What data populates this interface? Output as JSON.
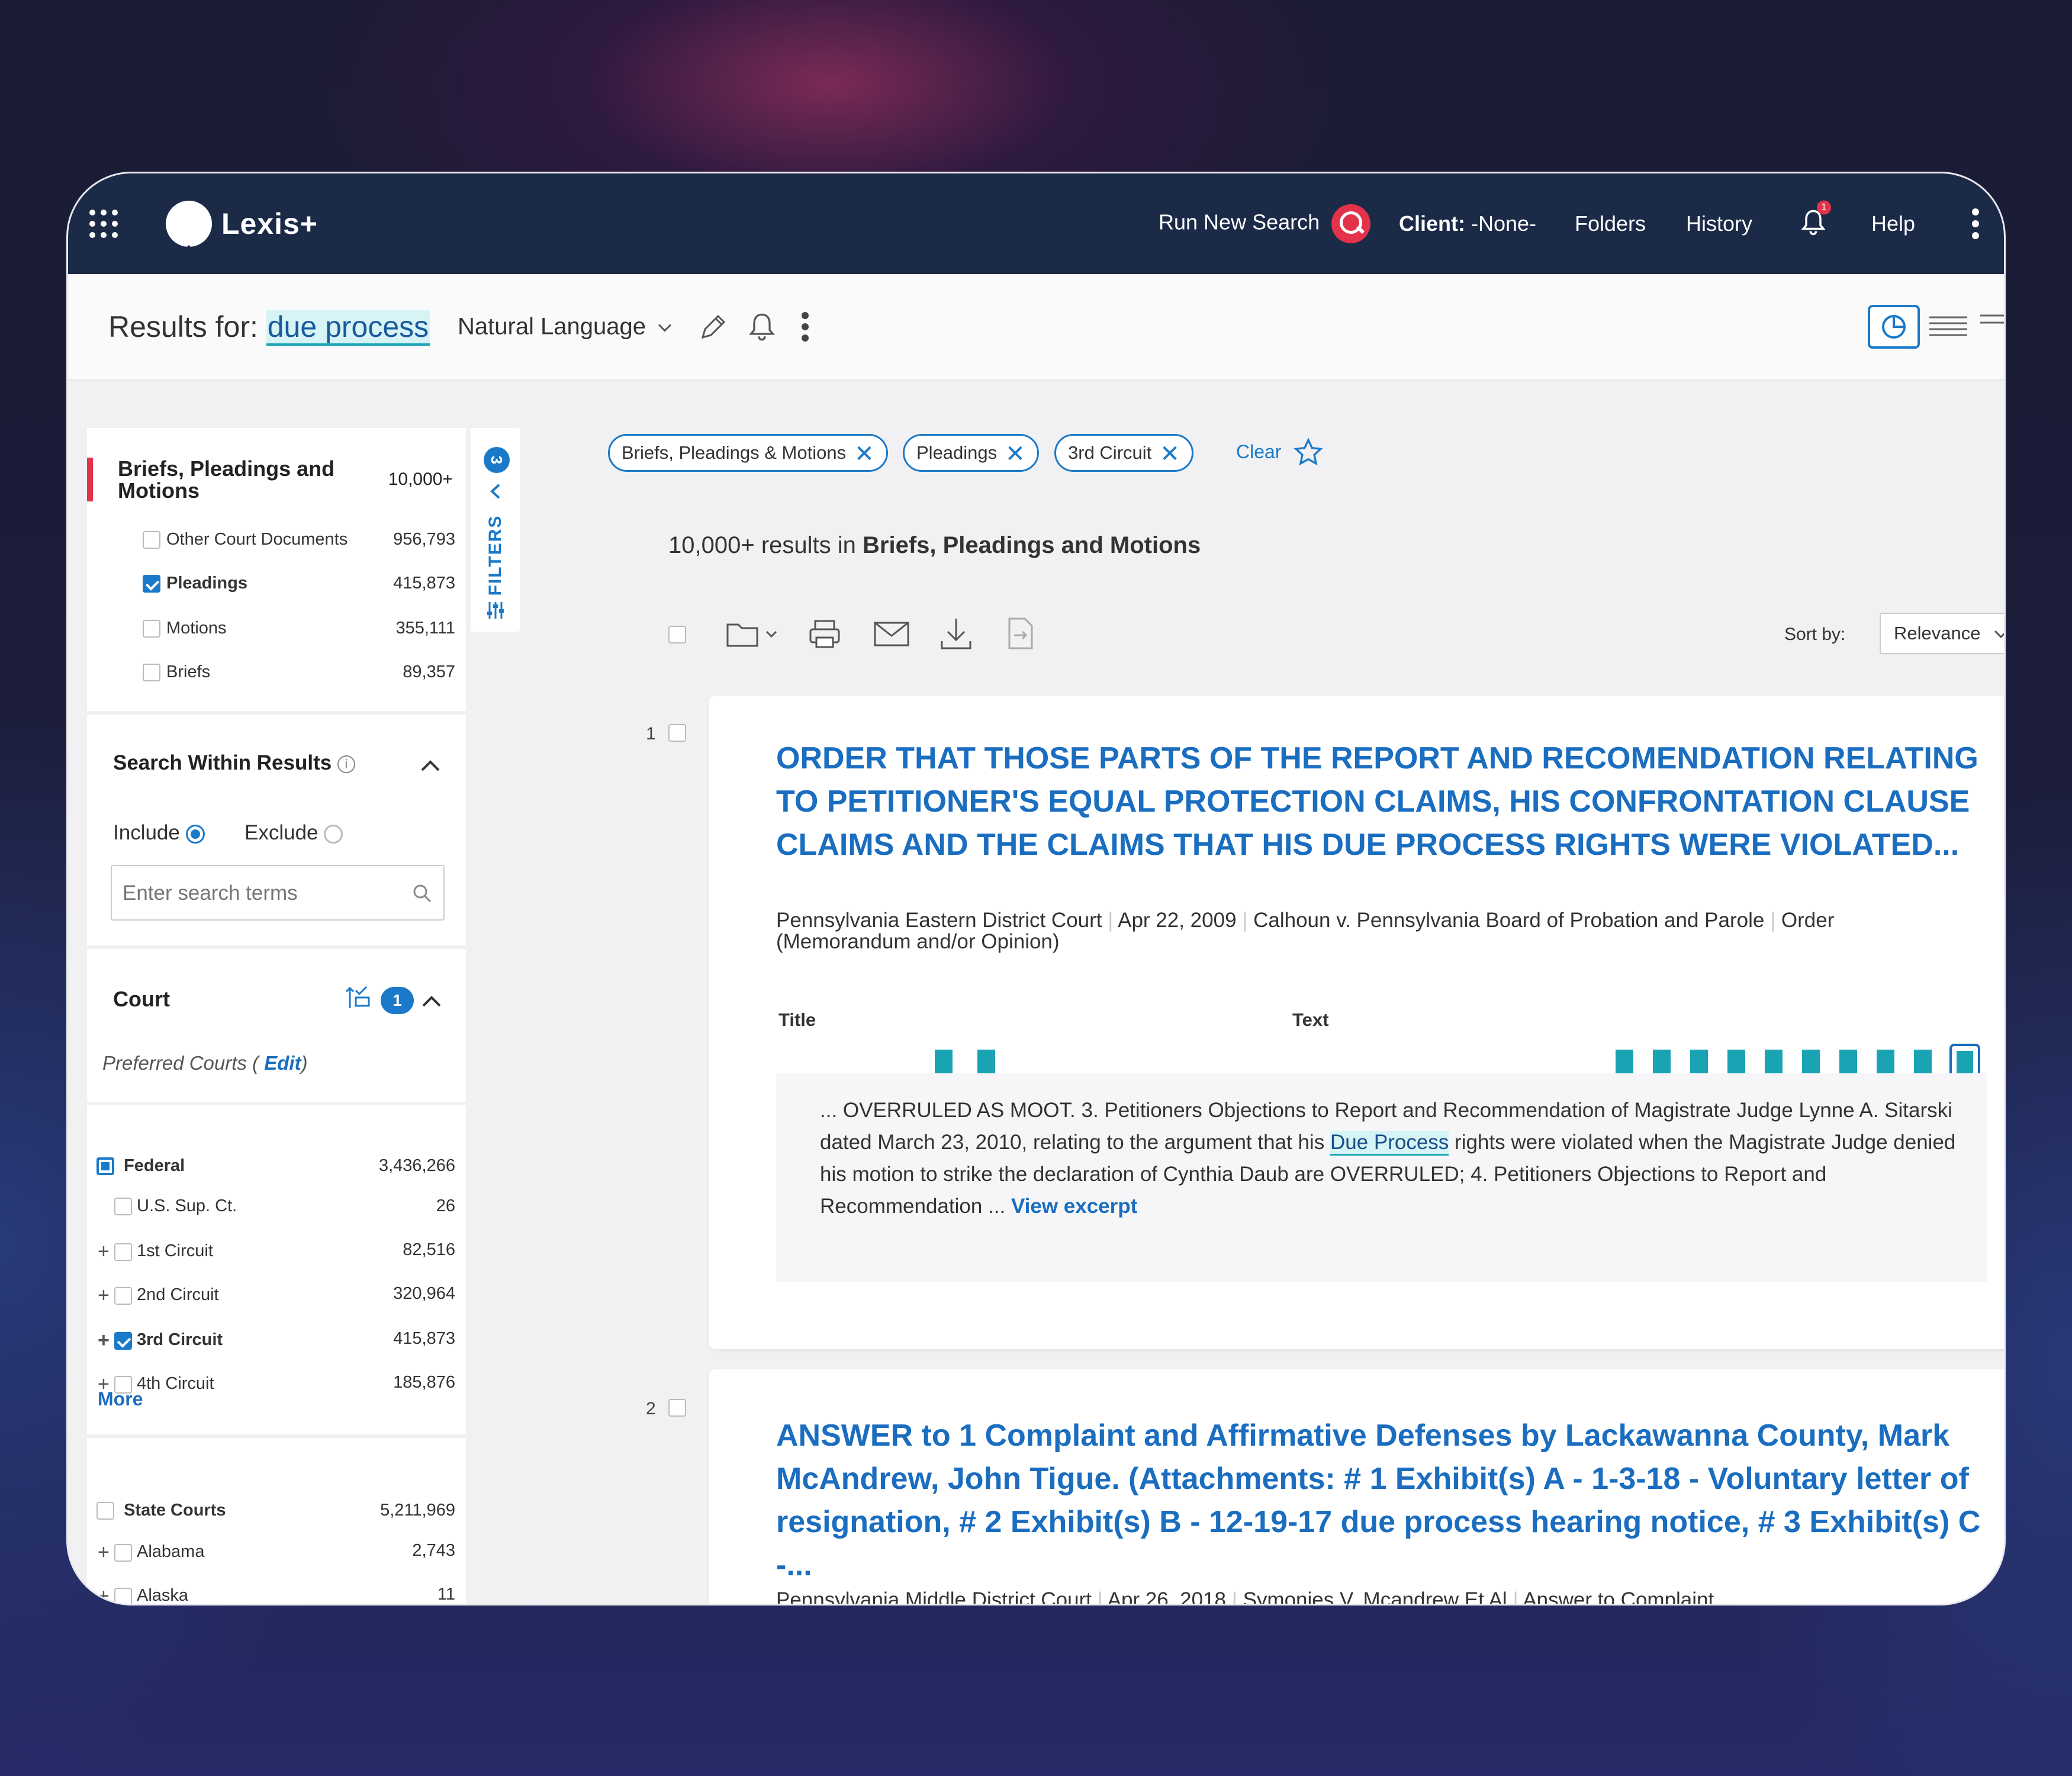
{
  "header": {
    "logo_text": "Lexis+",
    "run_new_search": "Run New Search",
    "client_label": "Client:",
    "client_value": " -None-",
    "folders": "Folders",
    "history": "History",
    "notification_count": "1",
    "help": "Help"
  },
  "results_bar": {
    "results_for": "Results for: ",
    "query": "due process",
    "search_type": "Natural Language"
  },
  "sidebar": {
    "category": {
      "label_line1": "Briefs, Pleadings and",
      "label_line2": "Motions",
      "count": "10,000+"
    },
    "doc_types": [
      {
        "label": "Other Court Documents",
        "count": "956,793",
        "checked": false
      },
      {
        "label": "Pleadings",
        "count": "415,873",
        "checked": true
      },
      {
        "label": "Motions",
        "count": "355,111",
        "checked": false
      },
      {
        "label": "Briefs",
        "count": "89,357",
        "checked": false
      }
    ],
    "search_within": {
      "title": "Search Within Results",
      "include": "Include",
      "exclude": "Exclude",
      "placeholder": "Enter search terms"
    },
    "court": {
      "title": "Court",
      "badge": "1",
      "preferred_prefix": "Preferred Courts ( ",
      "preferred_edit": "Edit",
      "preferred_suffix": ")",
      "federal": {
        "label": "Federal",
        "count": "3,436,266"
      },
      "federal_items": [
        {
          "label": "U.S. Sup. Ct.",
          "count": "26",
          "expandable": false,
          "checked": false
        },
        {
          "label": "1st Circuit",
          "count": "82,516",
          "expandable": true,
          "checked": false
        },
        {
          "label": "2nd Circuit",
          "count": "320,964",
          "expandable": true,
          "checked": false
        },
        {
          "label": "3rd Circuit",
          "count": "415,873",
          "expandable": true,
          "checked": true
        },
        {
          "label": "4th Circuit",
          "count": "185,876",
          "expandable": true,
          "checked": false
        }
      ],
      "more": "More",
      "state": {
        "label": "State Courts",
        "count": "5,211,969"
      },
      "state_items": [
        {
          "label": "Alabama",
          "count": "2,743"
        },
        {
          "label": "Alaska",
          "count": "11"
        }
      ]
    }
  },
  "filters_tab": {
    "count": "3",
    "label": "FILTERS"
  },
  "chips": [
    {
      "label": "Briefs, Pleadings & Motions"
    },
    {
      "label": "Pleadings"
    },
    {
      "label": "3rd Circuit"
    }
  ],
  "clear_label": "Clear",
  "summary": {
    "prefix": "10,000+ results in ",
    "category": "Briefs, Pleadings and Motions"
  },
  "sort": {
    "label": "Sort by:",
    "value": "Relevance"
  },
  "results": [
    {
      "number": "1",
      "title": "ORDER THAT THOSE PARTS OF THE REPORT AND RECOMENDATION RELATING TO PETITIONER'S EQUAL PROTECTION CLAIMS, HIS CONFRONTATION CLAUSE CLAIMS AND THE CLAIMS THAT HIS DUE PROCESS RIGHTS WERE VIOLATED...",
      "court": "Pennsylvania Eastern District Court",
      "date": "Apr 22, 2009",
      "case": "Calhoun v. Pennsylvania Board of Probation and Parole",
      "doc_type": "Order (Memorandum and/or Opinion)",
      "map_title_label": "Title",
      "map_text_label": "Text",
      "snippet_before": "... OVERRULED AS MOOT. 3. Petitioners Objections to Report and Recommendation of Magistrate Judge Lynne A. Sitarski dated March 23, 2010, relating to the argument that his ",
      "snippet_highlight": "Due Process",
      "snippet_after": " rights were violated when the Magistrate Judge denied his motion to strike the declaration of Cynthia Daub are OVERRULED; 4. Petitioners Objections to Report and Recommendation ... ",
      "view_excerpt": "View excerpt"
    },
    {
      "number": "2",
      "title": "ANSWER to 1 Complaint and Affirmative Defenses by Lackawanna County, Mark McAndrew, John Tigue. (Attachments: # 1 Exhibit(s) A - 1-3-18 - Voluntary letter of resignation, # 2 Exhibit(s) B - 12-19-17 due process hearing notice, # 3 Exhibit(s) C -...",
      "court": "Pennsylvania Middle District Court",
      "date": "Apr 26, 2018",
      "case": "Symonies V. Mcandrew Et Al",
      "doc_type": "Answer to Complaint"
    }
  ],
  "colors": {
    "topbar": "#1b2a47",
    "accent_blue": "#1a6dbf",
    "teal": "#19a3b3",
    "red": "#e2334a"
  }
}
